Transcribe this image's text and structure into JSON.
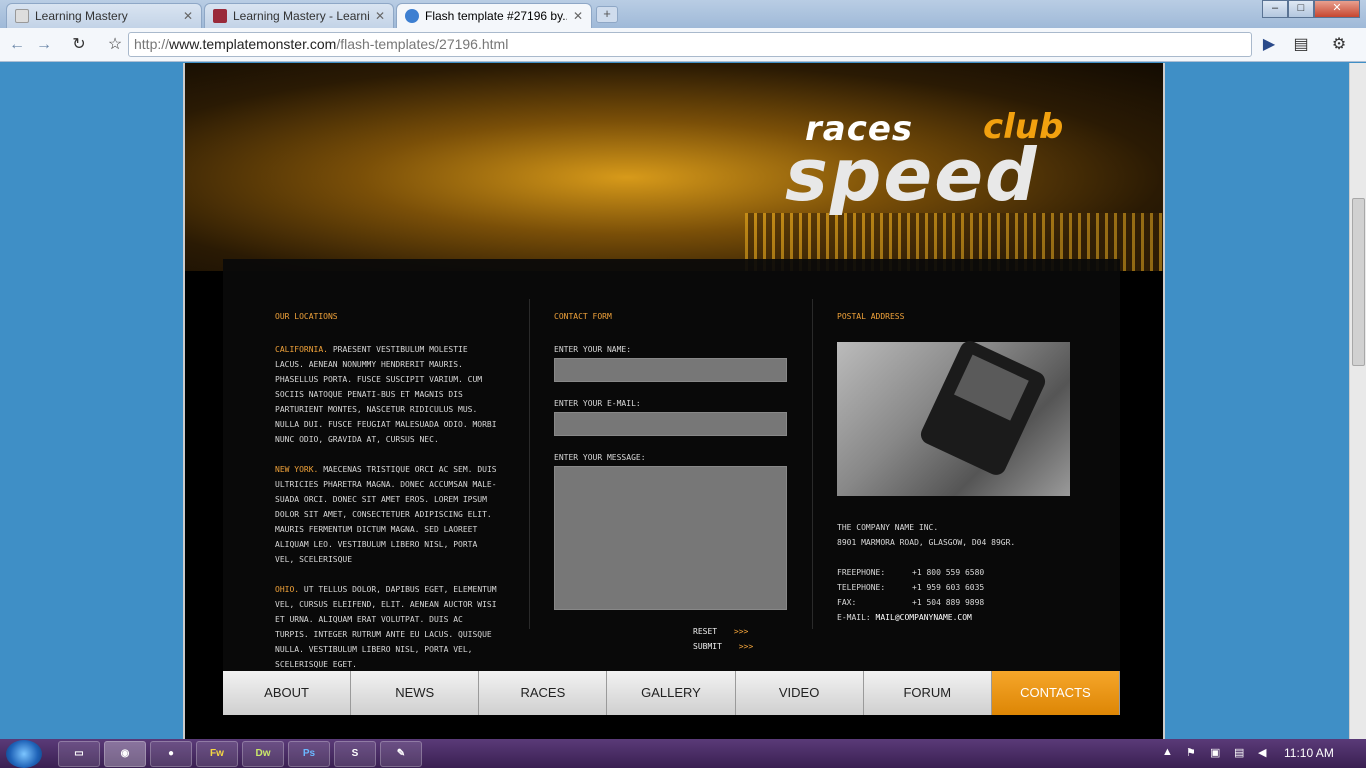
{
  "tabs": [
    {
      "title": "Learning Mastery",
      "active": false
    },
    {
      "title": "Learning Mastery - Learni...",
      "active": false
    },
    {
      "title": "Flash template #27196 by...",
      "active": true
    }
  ],
  "toolbar": {
    "url_host": "www.templatemonster.com",
    "url_prefix": "http://",
    "url_path": "/flash-templates/27196.html"
  },
  "brand": {
    "line1": "races",
    "line2": "club",
    "line3": "speed"
  },
  "locations": {
    "heading": "OUR LOCATIONS",
    "items": [
      {
        "city": "CALIFORNIA.",
        "text": "PRAESENT VESTIBULUM MOLESTIE LACUS. AENEAN NONUMMY HENDRERIT MAURIS. PHASELLUS PORTA. FUSCE SUSCIPIT VARIUM. CUM SOCIIS NATOQUE PENATI-BUS ET MAGNIS DIS PARTURIENT MONTES, NASCETUR RIDICULUS MUS. NULLA DUI. FUSCE FEUGIAT MALESUADA ODIO. MORBI NUNC ODIO, GRAVIDA AT, CURSUS NEC."
      },
      {
        "city": "NEW YORK.",
        "text": "MAECENAS TRISTIQUE ORCI AC SEM. DUIS ULTRICIES PHARETRA MAGNA. DONEC ACCUMSAN MALE-SUADA ORCI. DONEC SIT AMET EROS. LOREM IPSUM DOLOR SIT AMET, CONSECTETUER ADIPISCING ELIT. MAURIS FERMENTUM DICTUM MAGNA. SED LAOREET ALIQUAM LEO. VESTIBULUM LIBERO NISL, PORTA VEL, SCELERISQUE"
      },
      {
        "city": "OHIO.",
        "text": "UT TELLUS DOLOR, DAPIBUS EGET, ELEMENTUM VEL, CURSUS ELEIFEND, ELIT. AENEAN AUCTOR WISI ET URNA. ALIQUAM ERAT VOLUTPAT. DUIS AC TURPIS. INTEGER RUTRUM ANTE EU LACUS. QUISQUE NULLA. VESTIBULUM LIBERO NISL, PORTA VEL, SCELERISQUE EGET."
      }
    ]
  },
  "contact_form": {
    "heading": "CONTACT FORM",
    "name_label": "ENTER YOUR NAME:",
    "email_label": "ENTER YOUR E-MAIL:",
    "message_label": "ENTER YOUR MESSAGE:",
    "reset_label": "RESET",
    "submit_label": "SUBMIT",
    "arrow": ">>>"
  },
  "postal": {
    "heading": "POSTAL ADDRESS",
    "company": "THE COMPANY NAME INC.",
    "address": "8901 MARMORA ROAD, GLASGOW, D04 89GR.",
    "freephone_label": "FREEPHONE:",
    "freephone": "+1 800 559 6580",
    "telephone_label": "TELEPHONE:",
    "telephone": "+1 959 603 6035",
    "fax_label": "FAX:",
    "fax": "+1 504 889 9898",
    "email_label": "E-MAIL:",
    "email": "MAIL@COMPANYNAME.COM"
  },
  "menu": [
    "ABOUT",
    "NEWS",
    "RACES",
    "GALLERY",
    "VIDEO",
    "FORUM",
    "CONTACTS"
  ],
  "taskbar": {
    "apps": [
      "Fw",
      "Dw",
      "Ps"
    ],
    "clock": "11:10 AM"
  }
}
